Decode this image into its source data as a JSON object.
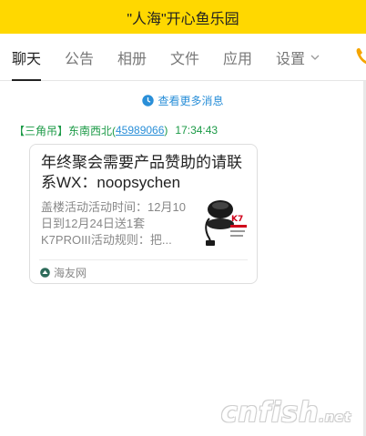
{
  "window": {
    "title": "\"人海\"开心鱼乐园"
  },
  "tabs": [
    {
      "label": "聊天",
      "active": true
    },
    {
      "label": "公告"
    },
    {
      "label": "相册"
    },
    {
      "label": "文件"
    },
    {
      "label": "应用"
    },
    {
      "label": "设置"
    }
  ],
  "chat": {
    "more_messages": "查看更多消息",
    "message": {
      "sender_prefix": "【三角吊】东南西北(",
      "sender_uid": "45989066",
      "sender_suffix": ")",
      "time": "17:34:43",
      "card": {
        "title": "年终聚会需要产品赞助的请联系WX：noopsychen",
        "description": "盖楼活动活动时间：12月10日到12月24日送1套K7PROIII活动规则：把...",
        "source": "海友网"
      }
    }
  },
  "watermark": {
    "text": "cnfish",
    "suffix": ".net"
  },
  "colors": {
    "titlebar": "#ffd800",
    "link": "#2a8fd8",
    "sender": "#1b9a46",
    "tab_active": "#222222",
    "tab_inactive": "#777777"
  },
  "icons": [
    "clock-icon",
    "chevron-down-icon",
    "phone-icon",
    "source-logo-icon",
    "product-thumbnail"
  ]
}
